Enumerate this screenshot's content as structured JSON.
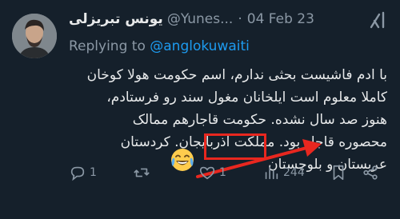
{
  "tweet": {
    "display_name": "یونس تبریزلی",
    "handle": "@Yunes...",
    "separator": "·",
    "date": "04 Feb 23",
    "replying_prefix": "Replying to",
    "replying_to": "@anglokuwaiti",
    "lines": [
      "با ادم فاشیست بحثی ندارم، اسم حکومت هولا کوخان",
      "کاملا معلوم است ایلخانان مغول سند رو فرستادم،",
      "هنوز صد سال نشده. حکومت قاجارهم ممالک",
      "محصوره قاجار بود. مملکت اذربایجان. کردستان",
      "عربستان و بلوچستان"
    ]
  },
  "actions": {
    "reply_count": "1",
    "retweet_count": "",
    "like_count": "1",
    "views_count": "244"
  },
  "annotation": {
    "emoji_name": "laughing-tears-emoji",
    "highlight_color": "#e8271f"
  },
  "icons": [
    "avatar",
    "grok-icon",
    "reply-icon",
    "retweet-icon",
    "like-icon",
    "views-icon",
    "bookmark-icon",
    "share-icon"
  ]
}
